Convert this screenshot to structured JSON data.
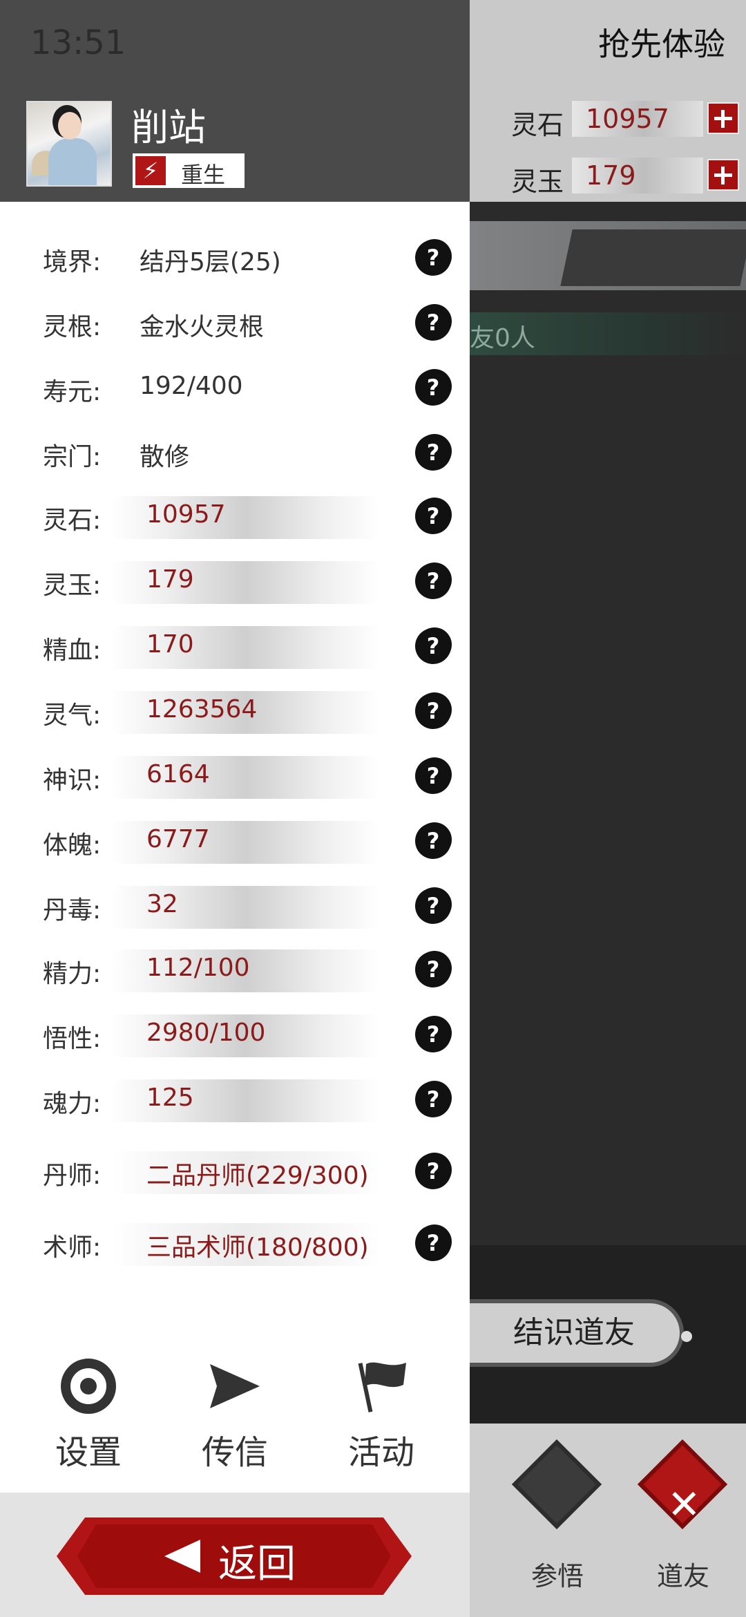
{
  "status_bar": {
    "time": "13:51"
  },
  "player": {
    "name": "削站",
    "badge": "重生"
  },
  "right_panel": {
    "title": "抢先体验",
    "currencies": [
      {
        "label": "灵石",
        "value": "10957"
      },
      {
        "label": "灵玉",
        "value": "179"
      }
    ],
    "friends_strip": "友0人",
    "meet_button": "结识道友",
    "bottom_nav": [
      {
        "label": "参悟",
        "icon": "enlightenment-icon"
      },
      {
        "label": "道友",
        "icon": "close-icon"
      }
    ]
  },
  "stats": [
    {
      "label": "境界:",
      "value": "结丹5层(25)"
    },
    {
      "label": "灵根:",
      "value": "金水火灵根"
    },
    {
      "label": "寿元:",
      "value": "192/400"
    },
    {
      "label": "宗门:",
      "value": "散修"
    },
    {
      "label": "灵石:",
      "value": "10957"
    },
    {
      "label": "灵玉:",
      "value": "179"
    },
    {
      "label": "精血:",
      "value": "170"
    },
    {
      "label": "灵气:",
      "value": "1263564"
    },
    {
      "label": "神识:",
      "value": "6164"
    },
    {
      "label": "体魄:",
      "value": "6777"
    },
    {
      "label": "丹毒:",
      "value": "32"
    },
    {
      "label": "精力:",
      "value": "112/100"
    },
    {
      "label": "悟性:",
      "value": "2980/100"
    },
    {
      "label": "魂力:",
      "value": "125"
    },
    {
      "label": "丹师:",
      "value": "二品丹师(229/300)"
    },
    {
      "label": "术师:",
      "value": "三品术师(180/800)"
    }
  ],
  "menu": [
    {
      "label": "设置",
      "icon": "gear-icon"
    },
    {
      "label": "传信",
      "icon": "send-icon"
    },
    {
      "label": "活动",
      "icon": "flag-icon"
    }
  ],
  "back_button": "返回",
  "colors": {
    "accent_red": "#b01414",
    "value_red": "#8b1a1a",
    "header_gray": "#4a4a4a"
  }
}
